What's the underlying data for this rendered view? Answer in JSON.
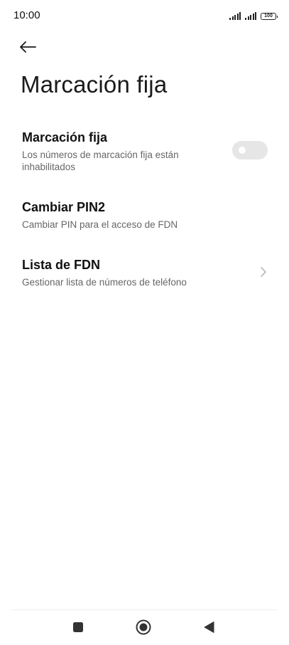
{
  "status_bar": {
    "time": "10:00",
    "battery": "100",
    "icons": [
      "signal-icon",
      "signal-icon",
      "battery-icon"
    ]
  },
  "header": {
    "back_icon": "arrow-left-icon",
    "title": "Marcación fija"
  },
  "settings": {
    "fixed_dialing": {
      "title": "Marcación fija",
      "subtitle": "Los números de marcación fija están inhabilitados",
      "toggle_on": false
    },
    "change_pin2": {
      "title": "Cambiar PIN2",
      "subtitle": "Cambiar PIN para el acceso de FDN"
    },
    "fdn_list": {
      "title": "Lista de FDN",
      "subtitle": "Gestionar lista de números de teléfono",
      "icon": "chevron-right-icon"
    }
  },
  "nav_bar": {
    "icons": [
      "square-recents-icon",
      "circle-home-icon",
      "triangle-back-icon"
    ]
  },
  "colors": {
    "background": "#ffffff",
    "text_primary": "#111111",
    "text_secondary": "#666666",
    "toggle_off": "#e6e6e6"
  }
}
